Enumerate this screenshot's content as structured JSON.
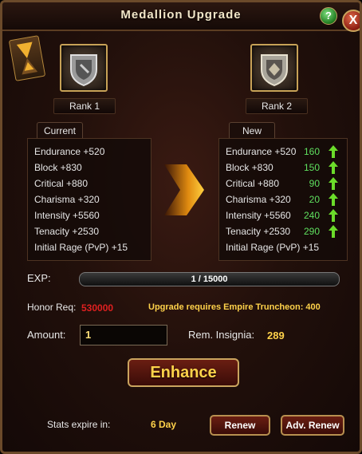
{
  "window": {
    "title": "Medallion Upgrade",
    "help_label": "?",
    "close_label": "X"
  },
  "ranks": {
    "current": "Rank 1",
    "next": "Rank 2"
  },
  "tabs": {
    "current": "Current",
    "new": "New"
  },
  "current_stats": [
    "Endurance +520",
    "Block +830",
    "Critical +880",
    "Charisma +320",
    "Intensity +5560",
    "Tenacity +2530",
    "Initial Rage (PvP) +15"
  ],
  "new_stats": [
    {
      "label": "Endurance +520",
      "bonus": "160"
    },
    {
      "label": "Block +830",
      "bonus": "150"
    },
    {
      "label": "Critical +880",
      "bonus": "90"
    },
    {
      "label": "Charisma +320",
      "bonus": "20"
    },
    {
      "label": "Intensity +5560",
      "bonus": "240"
    },
    {
      "label": "Tenacity +2530",
      "bonus": "290"
    },
    {
      "label": "Initial Rage (PvP) +15",
      "bonus": ""
    }
  ],
  "exp": {
    "label": "EXP:",
    "text": "1 / 15000",
    "progress": 6.67e-05
  },
  "honor": {
    "label": "Honor Req:",
    "value": "530000"
  },
  "upgrade_req": "Upgrade requires Empire Truncheon: 400",
  "amount": {
    "label": "Amount:",
    "value": "1"
  },
  "insignia": {
    "label": "Rem. Insignia:",
    "value": "289"
  },
  "enhance_label": "Enhance",
  "expire": {
    "label": "Stats expire in:",
    "value": "6 Day"
  },
  "buttons": {
    "renew": "Renew",
    "adv_renew": "Adv. Renew"
  },
  "colors": {
    "bonus": "#5fe05f",
    "honor_value": "#e02020",
    "accent_gold": "#ffd24a"
  }
}
